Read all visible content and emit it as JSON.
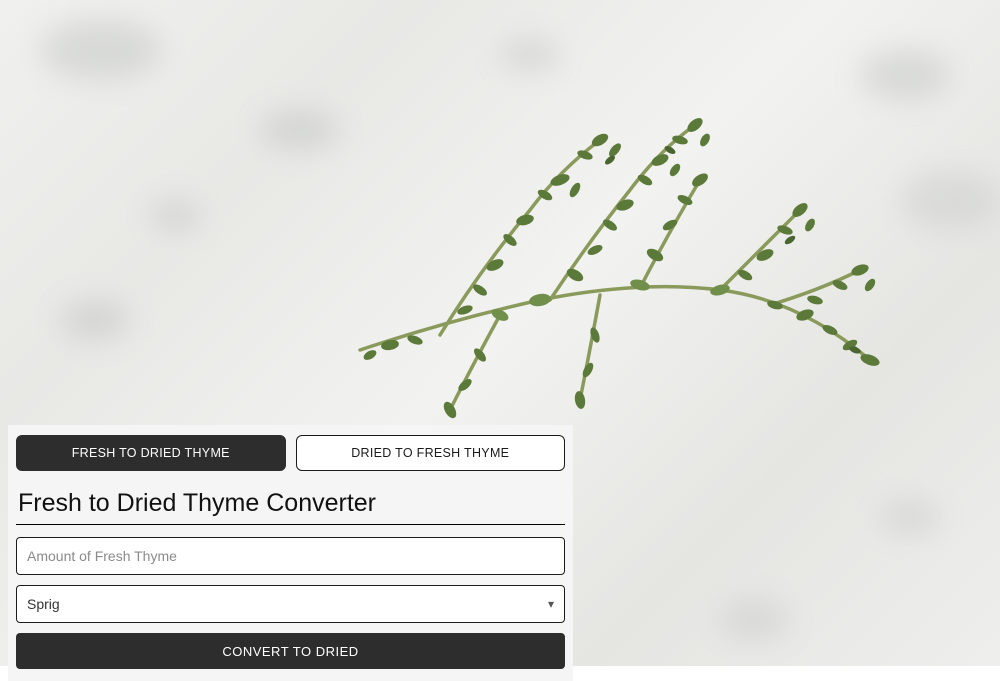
{
  "tabs": {
    "fresh_to_dried": "FRESH TO DRIED THYME",
    "dried_to_fresh": "DRIED TO FRESH THYME"
  },
  "converter": {
    "title": "Fresh to Dried Thyme Converter",
    "amount_placeholder": "Amount of Fresh Thyme",
    "amount_value": "",
    "unit_selected": "Sprig",
    "convert_label": "CONVERT TO DRIED"
  }
}
